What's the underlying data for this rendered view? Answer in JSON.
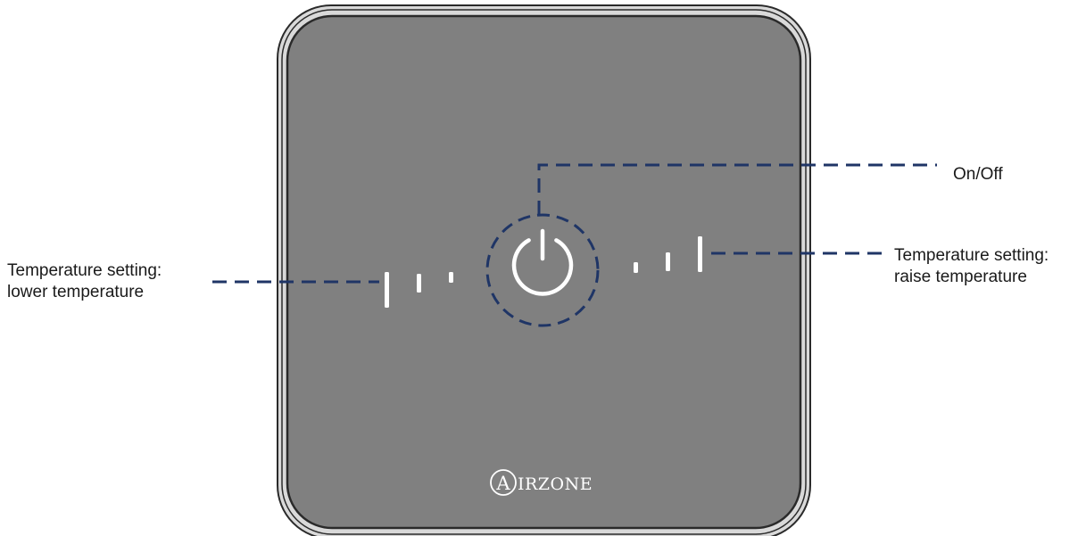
{
  "colors": {
    "background": "#ffffff",
    "device_face": "#808080",
    "device_bezel": "#d9d9d9",
    "device_outline": "#2a2a2a",
    "leader_line": "#1f3566",
    "indicator": "#ffffff"
  },
  "device": {
    "brand_initial": "A",
    "brand_rest": "IRZONE",
    "power_button_icon": "power-icon",
    "lower_indicator_bars": 3,
    "raise_indicator_bars": 3
  },
  "callouts": {
    "on_off": "On/Off",
    "lower": {
      "line1": "Temperature setting:",
      "line2": "lower temperature"
    },
    "raise": {
      "line1": "Temperature setting:",
      "line2": "raise temperature"
    }
  }
}
